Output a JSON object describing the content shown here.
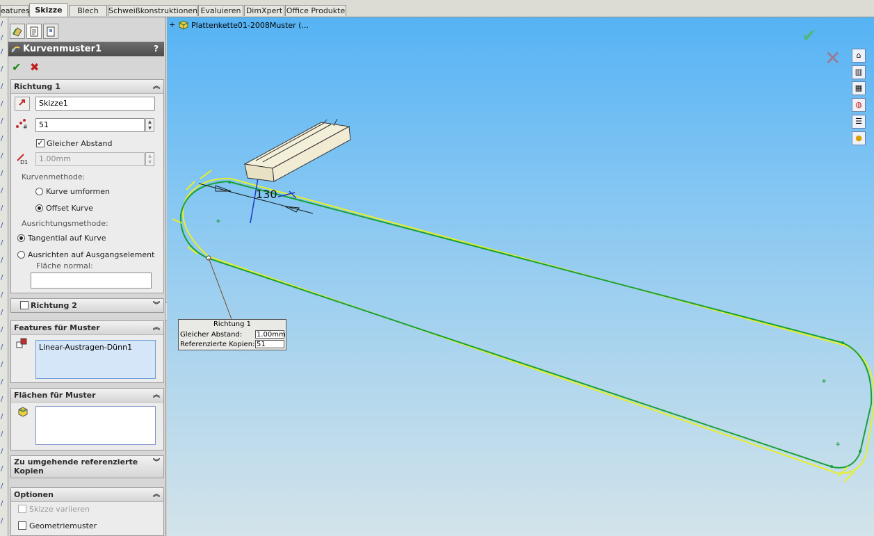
{
  "tabs": [
    "eatures",
    "Skizze",
    "Blech",
    "Schweißkonstruktionen",
    "Evaluieren",
    "DimXpert",
    "Office Produkte"
  ],
  "active_tab": "Skizze",
  "pm": {
    "title": "Kurvenmuster1",
    "help": "?",
    "ok": "✔",
    "cancel": "✖"
  },
  "richtung1": {
    "header": "Richtung 1",
    "curve_value": "Skizze1",
    "count_value": "51",
    "equal_spacing_label": "Gleicher Abstand",
    "equal_spacing_checked": true,
    "spacing_value": "1.00mm",
    "curve_method_label": "Kurvenmethode:",
    "curve_method_options": [
      "Kurve umformen",
      "Offset Kurve"
    ],
    "curve_method_selected": "Offset Kurve",
    "align_method_label": "Ausrichtungsmethode:",
    "align_options": [
      "Tangential auf Kurve",
      "Ausrichten auf Ausgangselement"
    ],
    "align_selected": "Tangential auf Kurve",
    "face_normal_label": "Fläche normal:"
  },
  "richtung2": {
    "header": "Richtung 2",
    "checked": false
  },
  "features": {
    "header": "Features für Muster",
    "items": [
      "Linear-Austragen-Dünn1"
    ]
  },
  "faces": {
    "header": "Flächen für Muster"
  },
  "skip": {
    "header": "Zu umgehende referenzierte Kopien"
  },
  "options": {
    "header": "Optionen",
    "vary_sketch": "Skizze variieren",
    "geometry_pattern": "Geometriemuster"
  },
  "viewport": {
    "document": "Plattenkette01-2008Muster (...",
    "dimension": "130",
    "callout": {
      "title": "Richtung 1",
      "rows": [
        {
          "label": "Gleicher Abstand:",
          "value": "1.00mm"
        },
        {
          "label": "Referenzierte Kopien:",
          "value": "51"
        }
      ]
    }
  },
  "colors": {
    "curve_green": "#1aa03a",
    "offset_yellow": "#e6ef2a",
    "sky_top": "#56b3f4",
    "sky_bottom": "#d3e3ea"
  },
  "icons": [
    "zoom-fit-icon",
    "zoom-area-icon",
    "previous-view-icon",
    "section-view-icon",
    "view-orientation-icon",
    "display-style-icon",
    "hide-show-icon",
    "edit-appearance-icon",
    "apply-scene-icon",
    "minimize-icon",
    "restore-icon",
    "close-icon",
    "home-icon",
    "design-library-icon",
    "file-explorer-icon",
    "view-palette-icon",
    "custom-properties-icon",
    "appearances-icon"
  ]
}
